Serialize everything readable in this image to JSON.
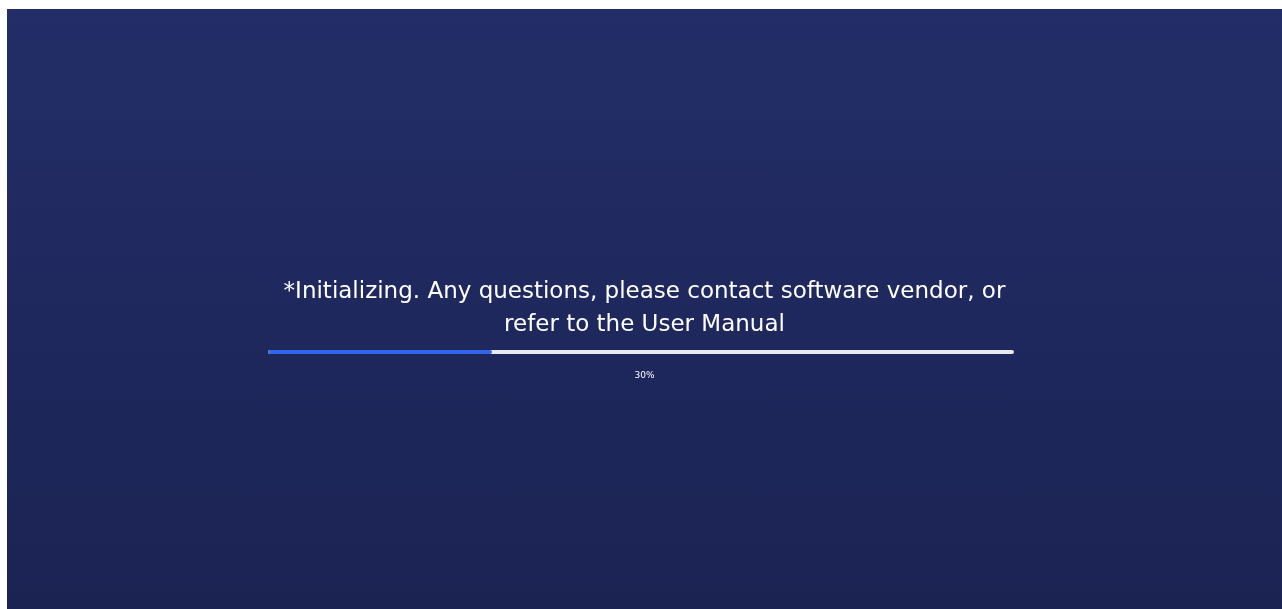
{
  "message": "*Initializing. Any questions, please contact software vendor, or refer to the User Manual",
  "progress": {
    "level": 0.3,
    "reading": "30%"
  }
}
